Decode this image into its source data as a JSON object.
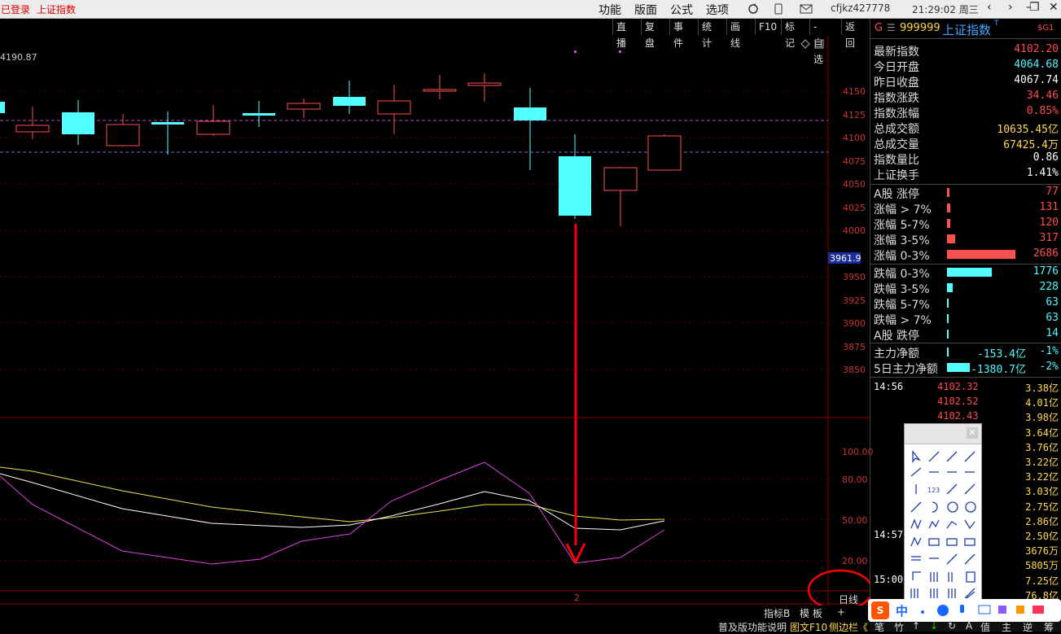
{
  "topbar": {
    "status": "已登录",
    "title": "上证指数",
    "menus": [
      "功能",
      "版面",
      "公式",
      "选项"
    ],
    "user": "cfjkz427778",
    "time": "21:29:02 周三",
    "win_buttons": [
      "‹",
      "›",
      "–",
      "❐",
      "✕"
    ]
  },
  "toolbar": {
    "buttons": [
      "直播",
      "复盘",
      "事件",
      "统计",
      "画线",
      "F10",
      "标记",
      "-自选",
      "返回"
    ]
  },
  "chart": {
    "max_label": "4190.87",
    "price_labels": [
      "4150",
      "4125",
      "4100",
      "4075",
      "4050",
      "4025",
      "4000",
      "3950",
      "3925",
      "3900",
      "3875",
      "3850"
    ],
    "current_tag": "3961.9",
    "osc_labels": [
      "100.00",
      "80.00",
      "50.00",
      "20.00"
    ],
    "axis_marker": "2",
    "period": "日线",
    "colors": {
      "up": "#ff5050",
      "down": "#54ffff",
      "ref_line": "#a040c0",
      "annotation": "#ff0000"
    }
  },
  "bottombar": {
    "tabs": [
      "指标B",
      "模 板",
      "+"
    ],
    "help": "普及版功能说明",
    "f10": "图文F10",
    "sidebar": "侧边栏《",
    "tools": [
      "笔",
      "竹",
      "↑",
      "↓",
      "↻",
      "A",
      "值",
      "主",
      "逆",
      "筹"
    ]
  },
  "quote": {
    "header": {
      "code": "999999",
      "name": "上证指数",
      "suffix": "T",
      "g": "G",
      "badge": "$G1"
    },
    "stats": [
      {
        "label": "最新指数",
        "value": "4102.20",
        "color": "red"
      },
      {
        "label": "今日开盘",
        "value": "4064.68",
        "color": "cyan"
      },
      {
        "label": "昨日收盘",
        "value": "4067.74",
        "color": "white"
      },
      {
        "label": "指数涨跌",
        "value": "34.46",
        "color": "red"
      },
      {
        "label": "指数涨幅",
        "value": "0.85%",
        "color": "red"
      },
      {
        "label": "总成交额",
        "value": "10635.45亿",
        "color": "yellow"
      },
      {
        "label": "总成交量",
        "value": "67425.4万",
        "color": "yellow"
      },
      {
        "label": "指数量比",
        "value": "0.86",
        "color": "white"
      },
      {
        "label": "上证换手",
        "value": "1.41%",
        "color": "white"
      }
    ],
    "ups": [
      {
        "label": "A股 涨停",
        "value": "77",
        "share": 0.03
      },
      {
        "label": "涨幅 > 7%",
        "value": "131",
        "share": 0.05
      },
      {
        "label": "涨幅 5-7%",
        "value": "120",
        "share": 0.045
      },
      {
        "label": "涨幅 3-5%",
        "value": "317",
        "share": 0.12
      },
      {
        "label": "涨幅 0-3%",
        "value": "2686",
        "share": 1.0
      }
    ],
    "downs": [
      {
        "label": "跌幅 0-3%",
        "value": "1776",
        "share": 0.66
      },
      {
        "label": "跌幅 3-5%",
        "value": "228",
        "share": 0.085
      },
      {
        "label": "跌幅 5-7%",
        "value": "63",
        "share": 0.024
      },
      {
        "label": "跌幅 > 7%",
        "value": "63",
        "share": 0.024
      },
      {
        "label": "A股 跌停",
        "value": "14",
        "share": 0.006
      }
    ],
    "flow": [
      {
        "label": "主力净额",
        "value": "-153.4亿",
        "pct": "-1%"
      },
      {
        "label": "5日主力净额",
        "value": "-1380.7亿",
        "pct": "-2%"
      }
    ],
    "ticks": [
      {
        "time": "14:56",
        "price": "4102.32",
        "amount": "3.38亿"
      },
      {
        "time": "",
        "price": "4102.52",
        "amount": "4.01亿"
      },
      {
        "time": "",
        "price": "4102.43",
        "amount": "3.98亿"
      },
      {
        "time": "",
        "price": "",
        "amount": "3.64亿"
      },
      {
        "time": "",
        "price": "",
        "amount": "3.76亿"
      },
      {
        "time": "",
        "price": "",
        "amount": "3.22亿"
      },
      {
        "time": "",
        "price": "",
        "amount": "3.22亿"
      },
      {
        "time": "",
        "price": "",
        "amount": "3.03亿"
      },
      {
        "time": "",
        "price": "",
        "amount": "2.75亿"
      },
      {
        "time": "",
        "price": "",
        "amount": "2.86亿"
      },
      {
        "time": "14:57",
        "price": "",
        "amount": "2.50亿"
      },
      {
        "time": "",
        "price": "",
        "amount": "3676万"
      },
      {
        "time": "",
        "price": "",
        "amount": "5805万"
      },
      {
        "time": "15:00",
        "price": "",
        "amount": "7.25亿"
      },
      {
        "time": "",
        "price": "",
        "amount": "76.8亿"
      },
      {
        "time": "",
        "price": "",
        "amount": ""
      }
    ]
  },
  "ime": {
    "logo": "S",
    "mode": "中"
  }
}
